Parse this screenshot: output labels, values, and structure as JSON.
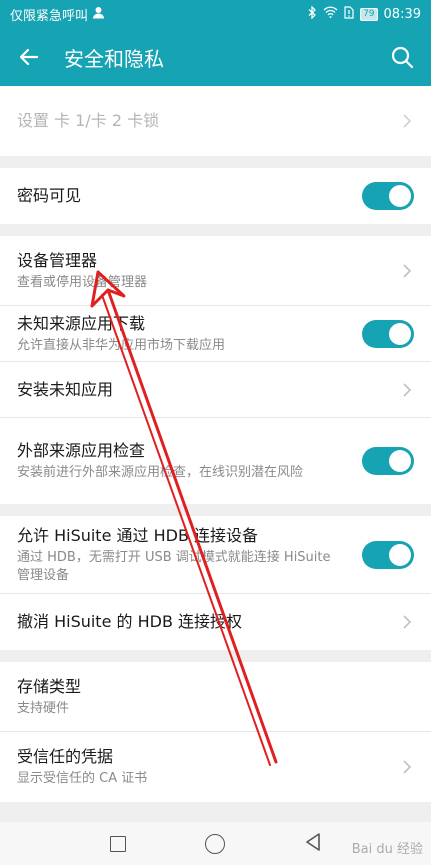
{
  "status_bar": {
    "left_text": "仅限紧急呼叫",
    "battery": "79",
    "time": "08:39"
  },
  "app_bar": {
    "title": "安全和隐私"
  },
  "sections": [
    {
      "rows": [
        {
          "title": "设置 卡 1/卡 2 卡锁",
          "subtitle": ""
        }
      ]
    },
    {
      "rows": [
        {
          "title": "密码可见",
          "subtitle": ""
        }
      ]
    },
    {
      "rows": [
        {
          "title": "设备管理器",
          "subtitle": "查看或停用设备管理器"
        },
        {
          "title": "未知来源应用下载",
          "subtitle": "允许直接从非华为应用市场下载应用"
        },
        {
          "title": "安装未知应用",
          "subtitle": ""
        },
        {
          "title": "外部来源应用检查",
          "subtitle": "安装前进行外部来源应用检查，在线识别潜在风险"
        }
      ]
    },
    {
      "rows": [
        {
          "title": "允许 HiSuite 通过 HDB 连接设备",
          "subtitle": "通过 HDB，无需打开 USB 调试模式就能连接 HiSuite 管理设备"
        },
        {
          "title": "撤消 HiSuite 的 HDB 连接授权",
          "subtitle": ""
        }
      ]
    },
    {
      "rows": [
        {
          "title": "存储类型",
          "subtitle": "支持硬件"
        },
        {
          "title": "受信任的凭据",
          "subtitle": "显示受信任的 CA 证书"
        }
      ]
    }
  ],
  "watermark": "Bai du 经验",
  "colors": {
    "accent": "#16a3b3",
    "annotation": "#e02020"
  }
}
